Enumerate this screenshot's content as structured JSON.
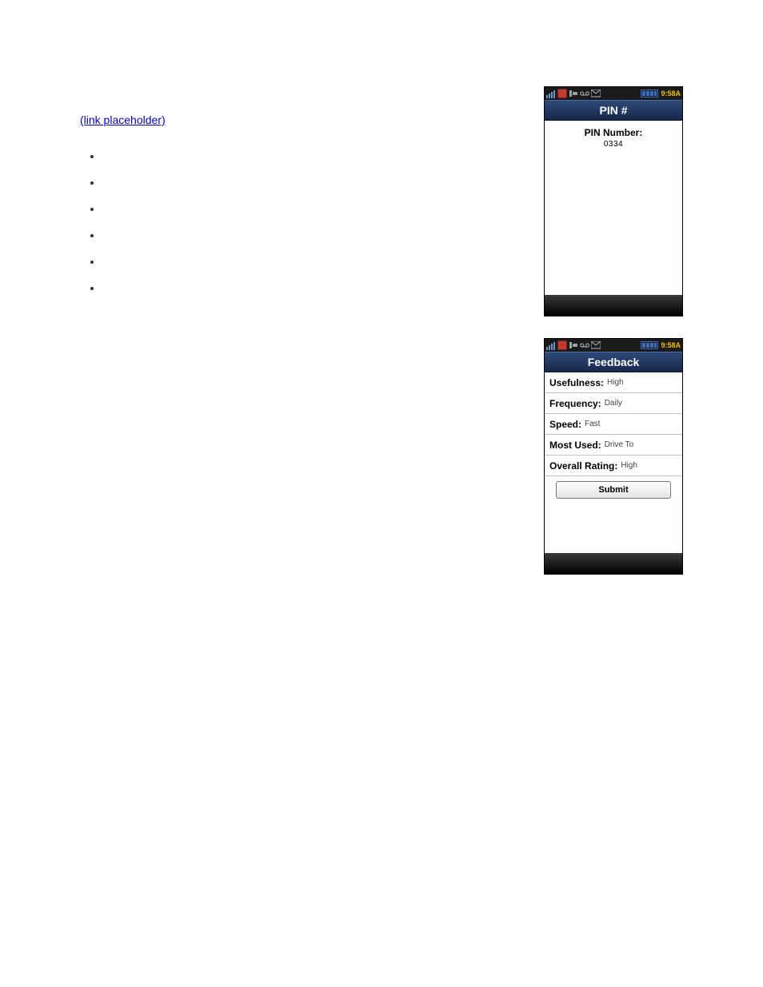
{
  "statusbar": {
    "time": "9:58A"
  },
  "pin_screen": {
    "title": "PIN #",
    "label": "PIN Number:",
    "value": "0334"
  },
  "feedback_screen": {
    "title": "Feedback",
    "rows": [
      {
        "label": "Usefulness:",
        "value": "High"
      },
      {
        "label": "Frequency:",
        "value": "Daily"
      },
      {
        "label": "Speed:",
        "value": "Fast"
      },
      {
        "label": "Most Used:",
        "value": "Drive To"
      },
      {
        "label": "Overall Rating:",
        "value": "High"
      }
    ],
    "submit_label": "Submit"
  },
  "doc": {
    "link_text": "(link placeholder)",
    "para_before_link": "",
    "para_after_link": "",
    "heading_feedback": "",
    "bullets": [
      "",
      "",
      "",
      "",
      "",
      ""
    ]
  }
}
